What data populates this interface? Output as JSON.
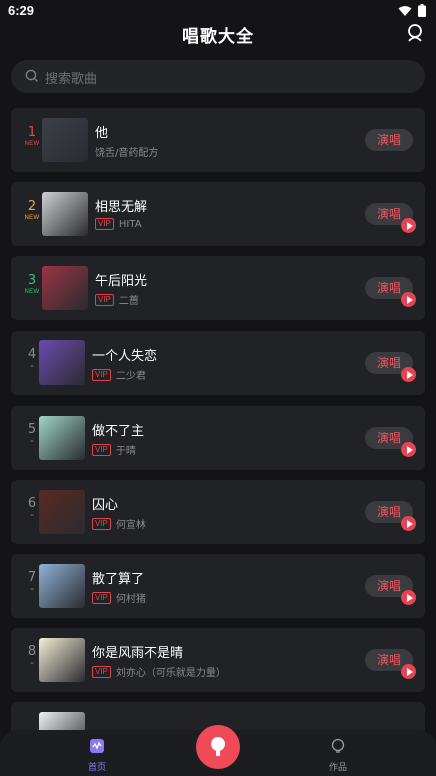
{
  "status": {
    "time": "6:29"
  },
  "header": {
    "title": "唱歌大全"
  },
  "search": {
    "placeholder": "搜索歌曲"
  },
  "songs": [
    {
      "rank": "1",
      "tag": "NEW",
      "title": "他",
      "artist": "饶舌/音药配方",
      "vip": false,
      "button": "演唱",
      "has_play": false,
      "rank_color": "#e34a4a",
      "tag_color": "#e34a4a"
    },
    {
      "rank": "2",
      "tag": "NEW",
      "title": "相思无解",
      "artist": "HITA",
      "vip": true,
      "button": "演唱",
      "has_play": true,
      "rank_color": "#f0a23a",
      "tag_color": "#f0a23a"
    },
    {
      "rank": "3",
      "tag": "NEW",
      "title": "午后阳光",
      "artist": "二蔷",
      "vip": true,
      "button": "演唱",
      "has_play": true,
      "rank_color": "#2fc27a",
      "tag_color": "#2fc27a"
    },
    {
      "rank": "4",
      "tag": "-",
      "title": "一个人失恋",
      "artist": "二少君",
      "vip": true,
      "button": "演唱",
      "has_play": true,
      "rank_color": "#8a8b90",
      "tag_color": "#8a8b90"
    },
    {
      "rank": "5",
      "tag": "-",
      "title": "做不了主",
      "artist": "于晴",
      "vip": true,
      "button": "演唱",
      "has_play": true,
      "rank_color": "#8a8b90",
      "tag_color": "#8a8b90"
    },
    {
      "rank": "6",
      "tag": "-",
      "title": "囚心",
      "artist": "何宣林",
      "vip": true,
      "button": "演唱",
      "has_play": true,
      "rank_color": "#8a8b90",
      "tag_color": "#8a8b90"
    },
    {
      "rank": "7",
      "tag": "-",
      "title": "散了算了",
      "artist": "何村猪",
      "vip": true,
      "button": "演唱",
      "has_play": true,
      "rank_color": "#8a8b90",
      "tag_color": "#8a8b90"
    },
    {
      "rank": "8",
      "tag": "-",
      "title": "你是风雨不是晴",
      "artist": "刘亦心（可乐就是力量）",
      "vip": true,
      "button": "演唱",
      "has_play": true,
      "rank_color": "#8a8b90",
      "tag_color": "#8a8b90"
    },
    {
      "rank": "",
      "tag": "",
      "title": "",
      "artist": "",
      "vip": false,
      "button": "",
      "has_play": false,
      "rank_color": "#8a8b90",
      "tag_color": "#8a8b90"
    }
  ],
  "vip_label": "VIP",
  "covers": [
    "#3b4048",
    "#cfd0d4",
    "#9b3444",
    "#6b4bb0",
    "#9fd6c8",
    "#5a2a22",
    "#8fb3d8",
    "#f4efd6",
    "#eef0f2"
  ],
  "tabs": {
    "home": "首页",
    "works": "作品"
  },
  "colors": {
    "accent": "#f04a58",
    "home_tab": "#8a7cf0"
  }
}
